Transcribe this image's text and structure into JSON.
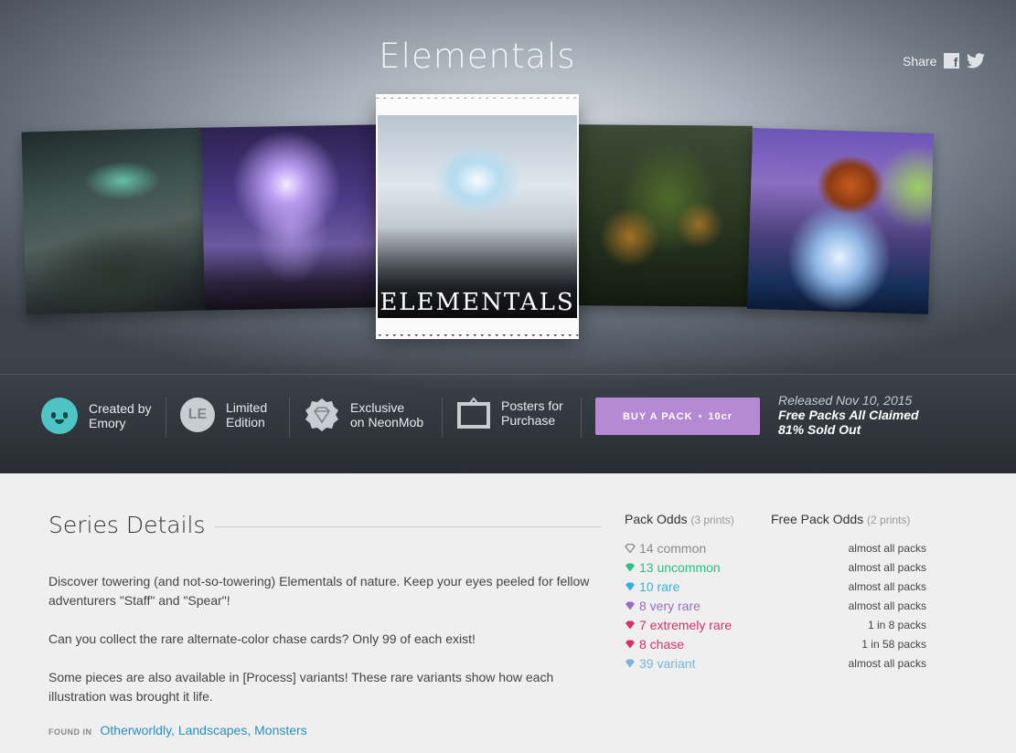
{
  "hero": {
    "title": "Elementals",
    "share_label": "Share",
    "pack_logo": "ELEMENTALS"
  },
  "info": {
    "creator_line1": "Created by",
    "creator_line2": "Emory",
    "edition_badge": "LE",
    "edition_line1": "Limited",
    "edition_line2": "Edition",
    "exclusive_line1": "Exclusive",
    "exclusive_line2": "on NeonMob",
    "posters_line1": "Posters for",
    "posters_line2": "Purchase",
    "buy_label": "BUY A PACK",
    "buy_dot": "•",
    "buy_price": "10cr",
    "released": "Released Nov 10, 2015",
    "free_packs": "Free Packs All Claimed",
    "sold_out": "81% Sold Out"
  },
  "details": {
    "heading": "Series Details",
    "para1": "Discover towering (and not-so-towering) Elementals of nature. Keep your eyes peeled for fellow adventurers \"Staff\" and \"Spear\"!",
    "para2": "Can you collect the rare alternate-color chase cards? Only 99 of each exist!",
    "para3": "Some pieces are also available in [Process] variants! These rare variants show how each illustration was brought it life.",
    "found_in_label": "FOUND IN",
    "tags": [
      "Otherworldly",
      "Landscapes",
      "Monsters"
    ]
  },
  "odds": {
    "pack_odds_label": "Pack Odds",
    "pack_odds_sub": "(3 prints)",
    "free_odds_label": "Free Pack Odds",
    "free_odds_sub": "(2 prints)",
    "rows": [
      {
        "label": "14 common",
        "free": "almost all packs",
        "color": "#888888"
      },
      {
        "label": "13 uncommon",
        "free": "almost all packs",
        "color": "#2cbf86"
      },
      {
        "label": "10 rare",
        "free": "almost all packs",
        "color": "#3ab0d9"
      },
      {
        "label": "8 very rare",
        "free": "almost all packs",
        "color": "#9a6cc8"
      },
      {
        "label": "7 extremely rare",
        "free": "1 in 8 packs",
        "color": "#d9306a"
      },
      {
        "label": "8 chase",
        "free": "1 in 58 packs",
        "color": "#d9306a"
      },
      {
        "label": "39 variant",
        "free": "almost all packs",
        "color": "#7fb2d6"
      }
    ]
  },
  "colors": {
    "buy_button": "#b589d3",
    "link": "#2a8fbf"
  }
}
